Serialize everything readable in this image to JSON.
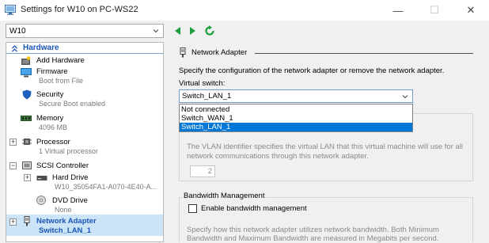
{
  "window": {
    "title": "Settings for W10 on PC-WS22",
    "minimize_glyph": "—",
    "maximize_glyph": "☐",
    "close_glyph": "✕"
  },
  "toolbar": {
    "vm_name": "W10"
  },
  "tree": {
    "section_title": "Hardware",
    "add_hardware": "Add Hardware",
    "firmware": {
      "label": "Firmware",
      "sub": "Boot from File"
    },
    "security": {
      "label": "Security",
      "sub": "Secure Boot enabled"
    },
    "memory": {
      "label": "Memory",
      "sub": "4096 MB"
    },
    "processor": {
      "label": "Processor",
      "sub": "1 Virtual processor"
    },
    "scsi": {
      "label": "SCSI Controller"
    },
    "hard_drive": {
      "label": "Hard Drive",
      "sub": "W10_35054FA1-A070-4E40-A..."
    },
    "dvd": {
      "label": "DVD Drive",
      "sub": "None"
    },
    "network_adapter": {
      "label": "Network Adapter",
      "sub": "Switch_LAN_1"
    }
  },
  "panel": {
    "group_title": "Network Adapter",
    "description": "Specify the configuration of the network adapter or remove the network adapter.",
    "virtual_switch_label": "Virtual switch:",
    "virtual_switch_value": "Switch_LAN_1",
    "switch_options": [
      "Not connected",
      "Switch_WAN_1",
      "Switch_LAN_1"
    ],
    "selected_option_index": 2,
    "vlan_text_1": "The VLAN identifier specifies the virtual LAN that this virtual machine will use for all",
    "vlan_text_2": "network communications through this network adapter.",
    "vlan_id": "2",
    "bandwidth_title": "Bandwidth Management",
    "bandwidth_checkbox_label": "Enable bandwidth management",
    "bandwidth_text_1": "Specify how this network adapter utilizes network bandwidth. Both Minimum",
    "bandwidth_text_2": "Bandwidth and Maximum Bandwidth are measured in Megabits per second."
  },
  "colors": {
    "accent": "#0078d7",
    "tree_link": "#1a56b6",
    "selection_bg": "#cce4f7",
    "nav_green": "#1e9e3e"
  }
}
